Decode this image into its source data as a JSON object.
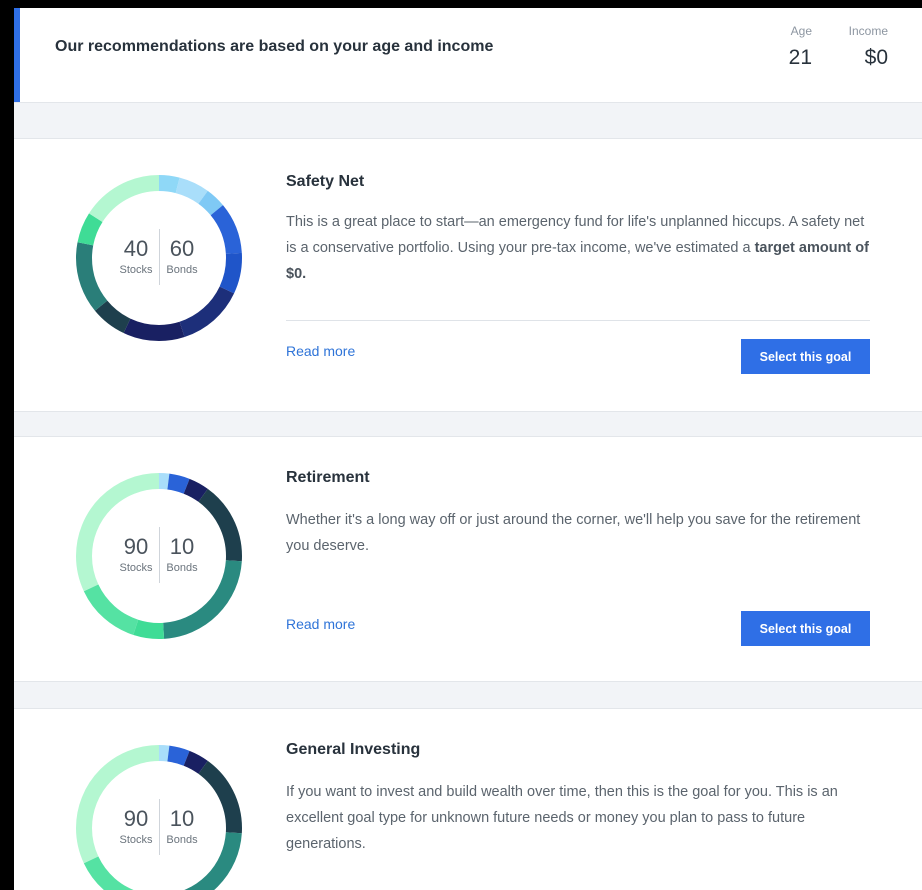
{
  "header": {
    "title": "Our recommendations are based on your age and income",
    "age_label": "Age",
    "age_value": "21",
    "income_label": "Income",
    "income_value": "$0"
  },
  "goals": [
    {
      "title": "Safety Net",
      "desc_before": "This is a great place to start—an emergency fund for life's unplanned hiccups. A safety net is a conservative portfolio. Using your pre-tax income, we've estimated a ",
      "desc_bold": "target amount of $0.",
      "stocks": "40",
      "bonds": "60",
      "stocks_label": "Stocks",
      "bonds_label": "Bonds",
      "read_more": "Read more",
      "select_label": "Select this goal",
      "segments": [
        {
          "frac": 0.04,
          "color": "#8fd8f7"
        },
        {
          "frac": 0.06,
          "color": "#a9defa"
        },
        {
          "frac": 0.04,
          "color": "#7fc9f5"
        },
        {
          "frac": 0.1,
          "color": "#2a63d8"
        },
        {
          "frac": 0.08,
          "color": "#1f55c9"
        },
        {
          "frac": 0.13,
          "color": "#1d2f7a"
        },
        {
          "frac": 0.12,
          "color": "#192062"
        },
        {
          "frac": 0.07,
          "color": "#1e3f4d"
        },
        {
          "frac": 0.14,
          "color": "#2a7e79"
        },
        {
          "frac": 0.06,
          "color": "#3fdc96"
        },
        {
          "frac": 0.16,
          "color": "#b4f7d1"
        }
      ]
    },
    {
      "title": "Retirement",
      "desc_before": "Whether it's a long way off or just around the corner, we'll help you save for the retirement you deserve.",
      "desc_bold": "",
      "stocks": "90",
      "bonds": "10",
      "stocks_label": "Stocks",
      "bonds_label": "Bonds",
      "read_more": "Read more",
      "select_label": "Select this goal",
      "segments": [
        {
          "frac": 0.02,
          "color": "#a9defa"
        },
        {
          "frac": 0.04,
          "color": "#2a63d8"
        },
        {
          "frac": 0.04,
          "color": "#192062"
        },
        {
          "frac": 0.16,
          "color": "#1e3f4d"
        },
        {
          "frac": 0.23,
          "color": "#2a8a80"
        },
        {
          "frac": 0.06,
          "color": "#3fdc96"
        },
        {
          "frac": 0.13,
          "color": "#55e2a3"
        },
        {
          "frac": 0.32,
          "color": "#b4f7d1"
        }
      ]
    },
    {
      "title": "General Investing",
      "desc_before": "If you want to invest and build wealth over time, then this is the goal for you. This is an excellent goal type for unknown future needs or money you plan to pass to future generations.",
      "desc_bold": "",
      "stocks": "90",
      "bonds": "10",
      "stocks_label": "Stocks",
      "bonds_label": "Bonds",
      "segments": [
        {
          "frac": 0.02,
          "color": "#a9defa"
        },
        {
          "frac": 0.04,
          "color": "#2a63d8"
        },
        {
          "frac": 0.04,
          "color": "#192062"
        },
        {
          "frac": 0.16,
          "color": "#1e3f4d"
        },
        {
          "frac": 0.23,
          "color": "#2a8a80"
        },
        {
          "frac": 0.06,
          "color": "#3fdc96"
        },
        {
          "frac": 0.13,
          "color": "#55e2a3"
        },
        {
          "frac": 0.32,
          "color": "#b4f7d1"
        }
      ]
    }
  ]
}
